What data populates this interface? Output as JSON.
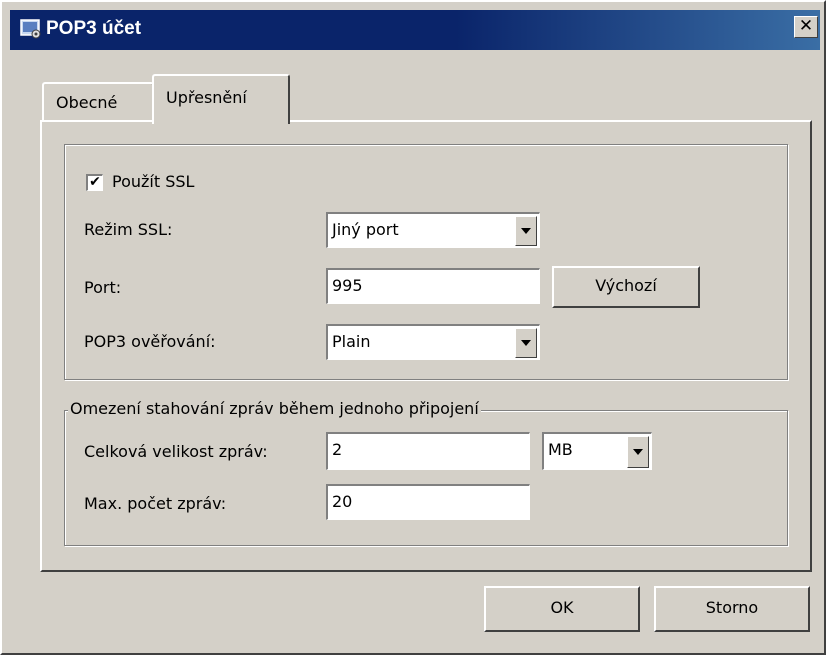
{
  "window": {
    "title": "POP3 účet",
    "close_glyph": "✕",
    "icon": "mail-account-icon"
  },
  "tabs": [
    {
      "label": "Obecné",
      "selected": false
    },
    {
      "label": "Upřesnění",
      "selected": true
    }
  ],
  "ssl": {
    "use_ssl_label": "Použít SSL",
    "use_ssl_checked": true,
    "check_glyph": "✔",
    "mode_label": "Režim SSL:",
    "mode_value": "Jiný port",
    "port_label": "Port:",
    "port_value": "995",
    "default_button": "Výchozí",
    "auth_label": "POP3 ověřování:",
    "auth_value": "Plain"
  },
  "limits": {
    "legend": "Omezení stahování zpráv během jednoho připojení",
    "total_size_label": "Celková velikost zpráv:",
    "total_size_value": "2",
    "unit_value": "MB",
    "max_count_label": "Max. počet zpráv:",
    "max_count_value": "20"
  },
  "footer": {
    "ok_label": "OK",
    "cancel_label": "Storno"
  }
}
